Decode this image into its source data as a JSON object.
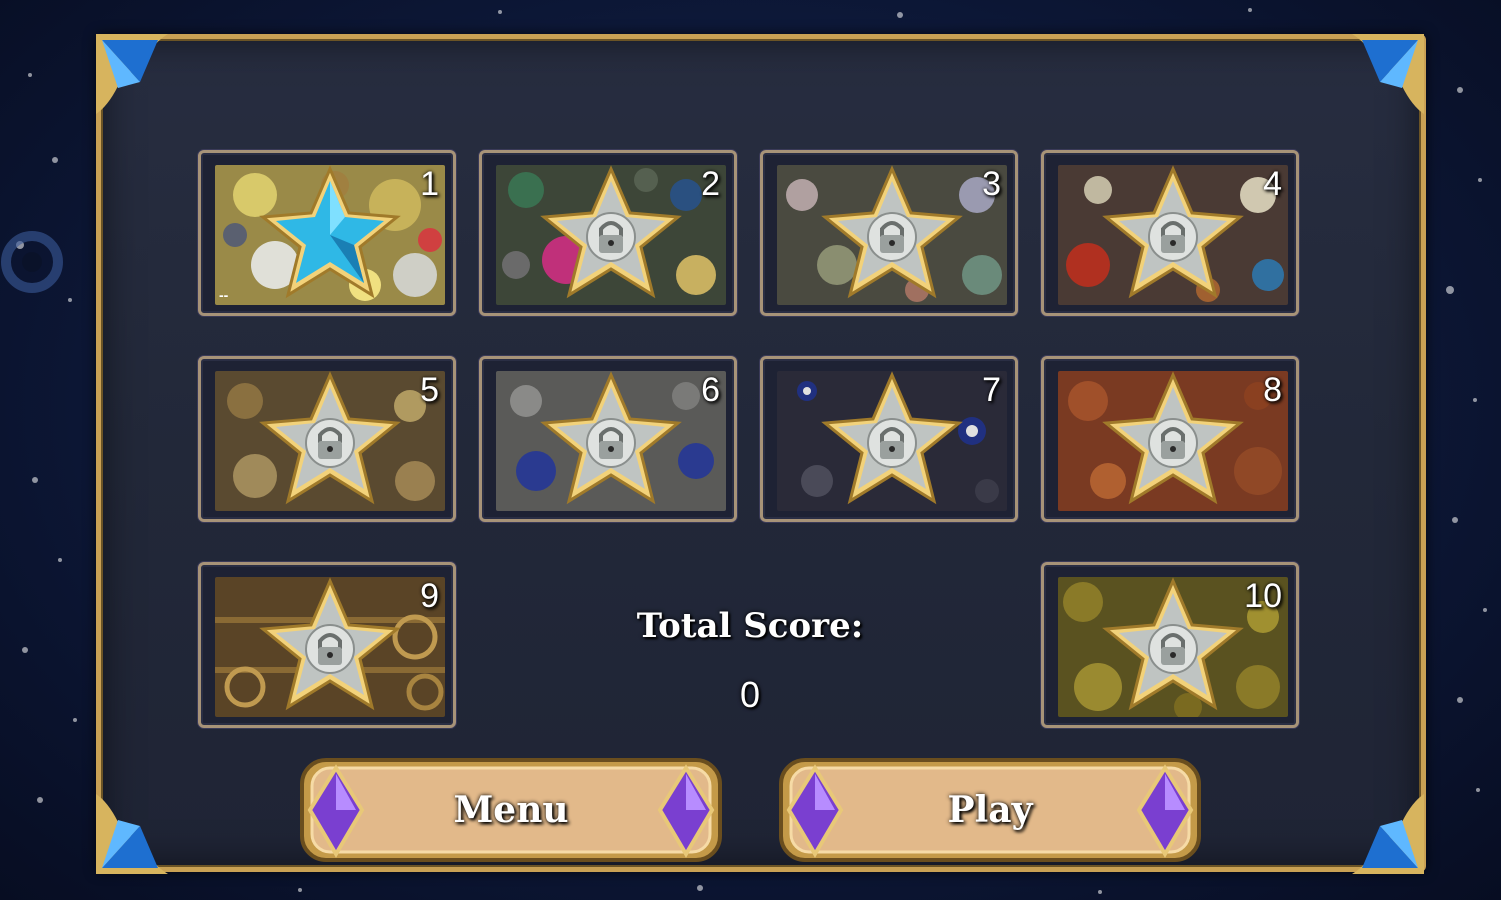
{
  "levels": [
    {
      "number": "1",
      "state": "unlocked",
      "icon": "blue-star-icon",
      "progress_mark": "--"
    },
    {
      "number": "2",
      "state": "locked",
      "icon": "locked-star-icon"
    },
    {
      "number": "3",
      "state": "locked",
      "icon": "locked-star-icon"
    },
    {
      "number": "4",
      "state": "locked",
      "icon": "locked-star-icon"
    },
    {
      "number": "5",
      "state": "locked",
      "icon": "locked-star-icon"
    },
    {
      "number": "6",
      "state": "locked",
      "icon": "locked-star-icon"
    },
    {
      "number": "7",
      "state": "locked",
      "icon": "locked-star-icon"
    },
    {
      "number": "8",
      "state": "locked",
      "icon": "locked-star-icon"
    },
    {
      "number": "9",
      "state": "locked",
      "icon": "locked-star-icon"
    },
    {
      "number": "10",
      "state": "locked",
      "icon": "locked-star-icon"
    }
  ],
  "score": {
    "label": "Total Score:",
    "value": "0"
  },
  "buttons": {
    "menu": "Menu",
    "play": "Play"
  },
  "colors": {
    "frame_gold": "#c9a154",
    "panel": "#232839",
    "button_fill": "#e2b98a",
    "gem_purple": "#7a3fd0",
    "unlocked_star": "#2fb8e6"
  }
}
